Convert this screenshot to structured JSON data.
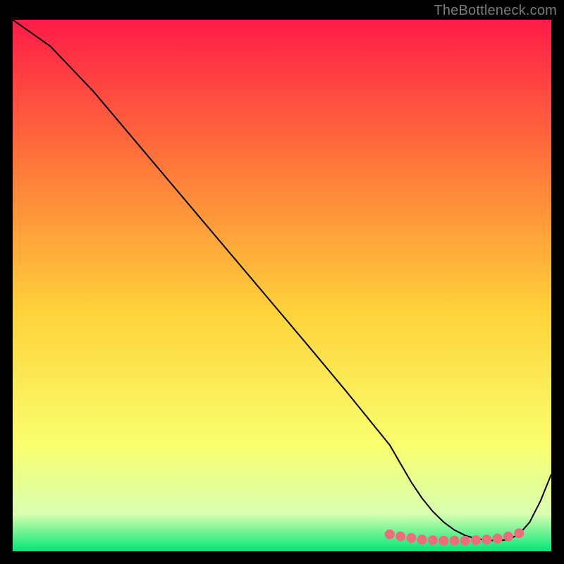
{
  "watermark": "TheBottleneck.com",
  "colors": {
    "bg_black": "#000000",
    "text_gray": "#7a7a7a",
    "curve": "#000000",
    "marker_fill": "#ef6d7a",
    "marker_stroke": "#ef6d7a",
    "grad_top": "#ff1b47",
    "grad_mid_upper": "#ff7a3a",
    "grad_mid": "#ffd23a",
    "grad_mid_lower": "#f9ff6e",
    "grad_green_pale": "#d8ffb0",
    "grad_green": "#00e676"
  },
  "chart_data": {
    "type": "line",
    "title": "",
    "xlabel": "",
    "ylabel": "",
    "xlim": [
      0,
      100
    ],
    "ylim": [
      0,
      100
    ],
    "series": [
      {
        "name": "bottleneck-curve",
        "x": [
          0,
          7,
          15,
          25,
          35,
          45,
          55,
          62,
          66,
          70,
          72,
          74,
          76,
          78,
          80,
          82,
          84,
          86,
          88,
          90,
          92,
          94,
          96,
          98,
          100
        ],
        "values": [
          100,
          95,
          86.5,
          74.5,
          62.5,
          50.5,
          38.5,
          30,
          25,
          20,
          16.5,
          13,
          10,
          7.5,
          5.5,
          4,
          3,
          2.4,
          2.1,
          2.0,
          2.2,
          3.2,
          5.5,
          9.5,
          14.5
        ]
      }
    ],
    "markers": {
      "name": "highlighted-range",
      "x": [
        70,
        72,
        74,
        76,
        78,
        80,
        82,
        84,
        86,
        88,
        90,
        92,
        94
      ],
      "values": [
        3.2,
        2.8,
        2.5,
        2.2,
        2.1,
        2.0,
        2.0,
        2.0,
        2.1,
        2.2,
        2.4,
        2.8,
        3.4
      ]
    }
  }
}
